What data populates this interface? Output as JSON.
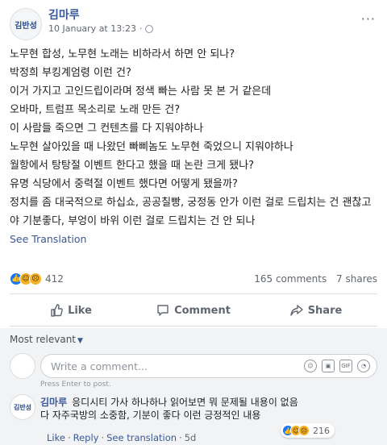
{
  "post": {
    "author": "김마루",
    "avatar_text": "김반성",
    "date": "10 January at 13:23",
    "privacy_dot": "·",
    "privacy_icon": "globe-icon",
    "more": "···",
    "lines": [
      "노무현 합성, 노무현 노래는 비하라서 하면 안 되나?",
      "박정희 부킹계엄령 이런 건?",
      "이거 가지고 고인드립이라며 정색 빠는 사람 못 본 거 같은데",
      "오바마, 트럼프 목소리로 노래 만든 건?",
      "이 사람들 죽으면 그 컨텐츠를 다 지워야하나",
      "노무현 살아있을 때 나왔던 빠삐놈도 노무현 죽었으니 지워야하나",
      "월항에서 탕탕절 이벤트 한다고 했을 때 논란 크게 됐나?",
      "유명 식당에서 중력절 이벤트 했다면 어떻게 됐을까?",
      "정치를 좀 대국적으로 하십쇼, 공공칠빵, 궁정동 안가 이런 걸로 드립치는 건 괜찮고",
      "야 기분좋다, 부엉이 바위 이런 걸로 드립치는 건 안 되나"
    ],
    "see_translation": "See Translation"
  },
  "stats": {
    "reactions": [
      "like",
      "haha",
      "sad"
    ],
    "reaction_count": "412",
    "comments": "165 comments",
    "shares": "7 shares"
  },
  "actions": {
    "like": "Like",
    "comment": "Comment",
    "share": "Share"
  },
  "comments": {
    "sort_label": "Most relevant",
    "sort_caret": "▼",
    "input_placeholder": "Write a comment...",
    "press_enter": "Press Enter to post.",
    "composer_icons": [
      "emoji-icon",
      "camera-icon",
      "gif-icon",
      "sticker-icon"
    ],
    "items": [
      {
        "avatar_text": "김반성",
        "author": "김마루",
        "text_line1": "응디시티 가사 하나하나 읽어보면 뭐 문제될 내용이 없음",
        "text_line2": "다 자주국방의 소중함, 기분이 좋다 이런 긍정적인 내용",
        "reactions": [
          "like",
          "haha",
          "sad"
        ],
        "reaction_count": "216",
        "like_label": "Like",
        "reply_label": "Reply",
        "see_translation": "See translation",
        "age": "5d"
      }
    ]
  },
  "colors": {
    "link": "#385898",
    "like_blue": "#1877f2",
    "emoji_yellow": "#f7b125",
    "muted": "#606770"
  }
}
